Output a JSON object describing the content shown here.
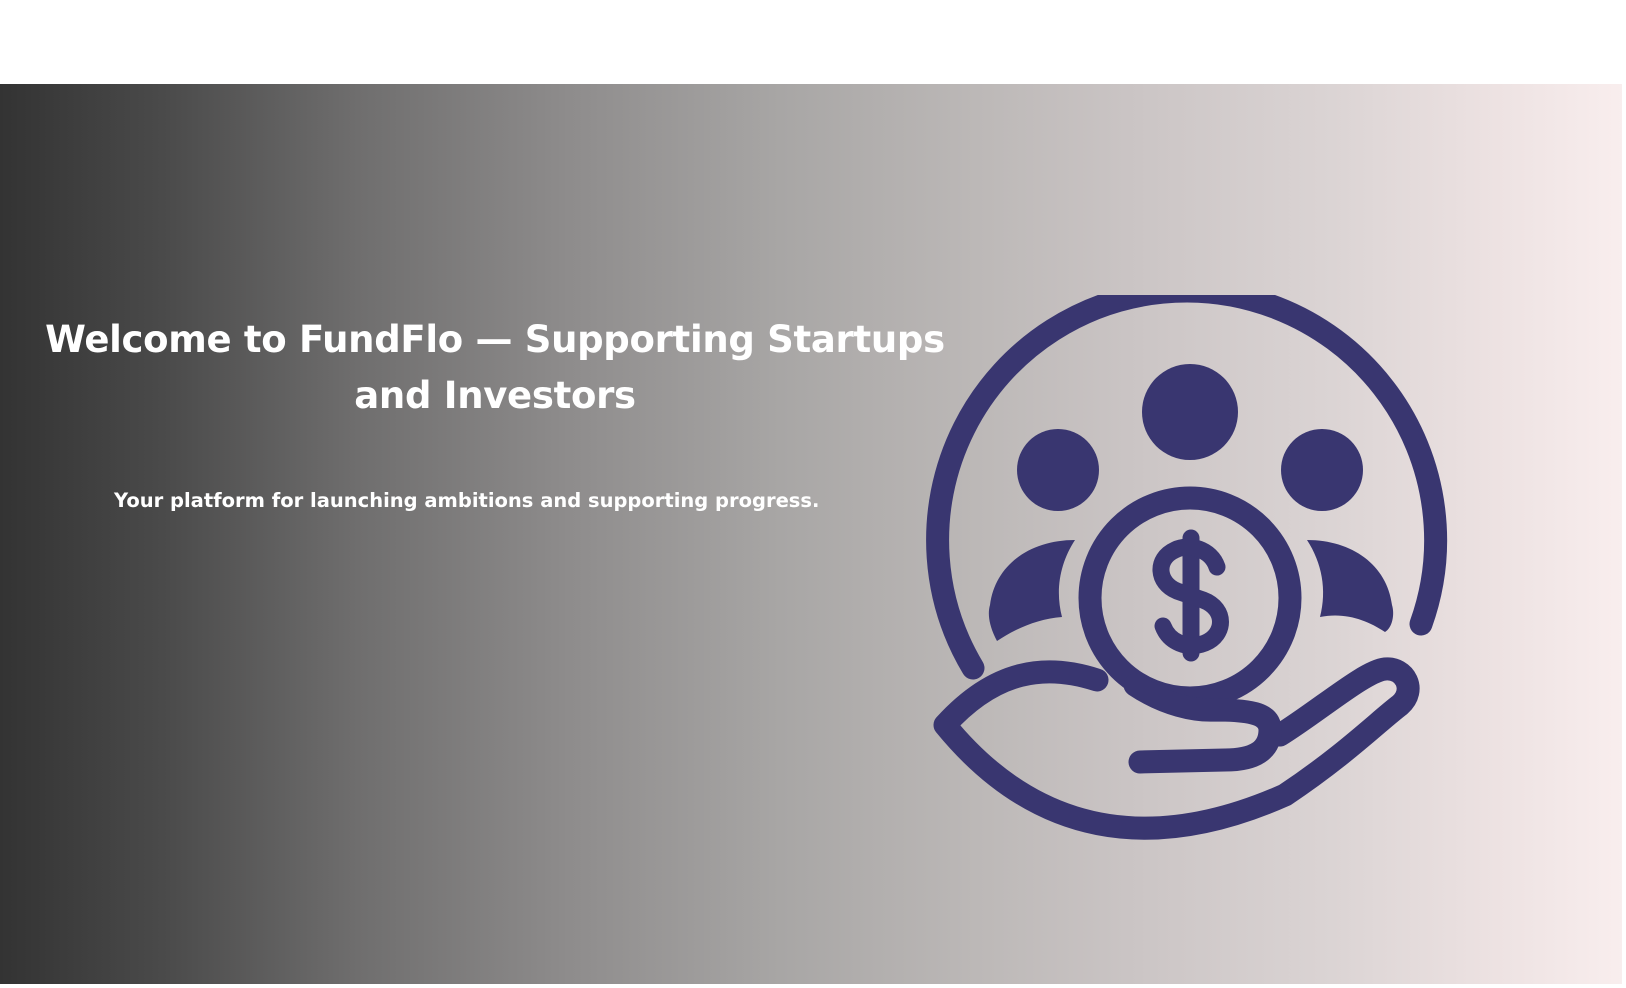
{
  "hero": {
    "headline": "Welcome to FundFlo — Supporting Startups and Investors",
    "tagline": "Your platform for launching ambitions and supporting progress.",
    "gradient_start": "#333333",
    "gradient_end": "#f9eeee",
    "text_color": "#ffffff"
  },
  "illustration": {
    "icon": "hand-holding-coin-investors-icon",
    "color": "#393670"
  }
}
